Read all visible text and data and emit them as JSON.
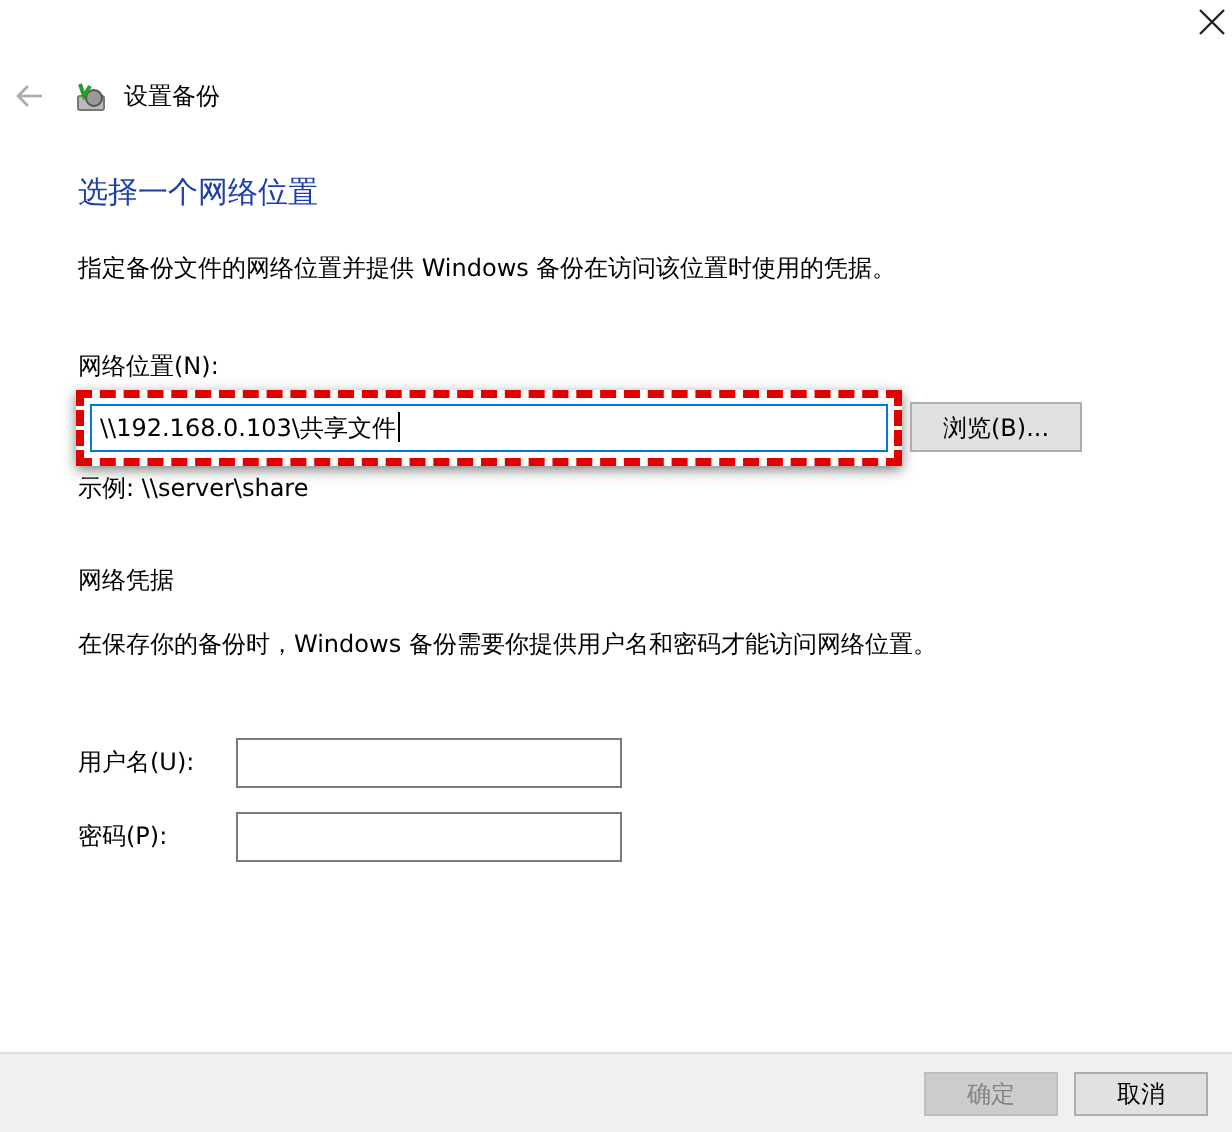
{
  "window": {
    "title": "设置备份",
    "back_enabled": false
  },
  "heading": "选择一个网络位置",
  "description": "指定备份文件的网络位置并提供 Windows 备份在访问该位置时使用的凭据。",
  "location": {
    "label": "网络位置(N):",
    "value": "\\\\192.168.0.103\\共享文件",
    "focused": true,
    "highlighted": true,
    "browse_button": "浏览(B)...",
    "example": "示例: \\\\server\\share"
  },
  "credentials": {
    "title": "网络凭据",
    "description": "在保存你的备份时，Windows 备份需要你提供用户名和密码才能访问网络位置。",
    "fields": [
      {
        "label": "用户名(U):"
      },
      {
        "label": "密码(P):"
      }
    ]
  },
  "buttons": [
    {
      "label": "确定",
      "disabled": true
    },
    {
      "label": "取消",
      "disabled": false
    }
  ]
}
